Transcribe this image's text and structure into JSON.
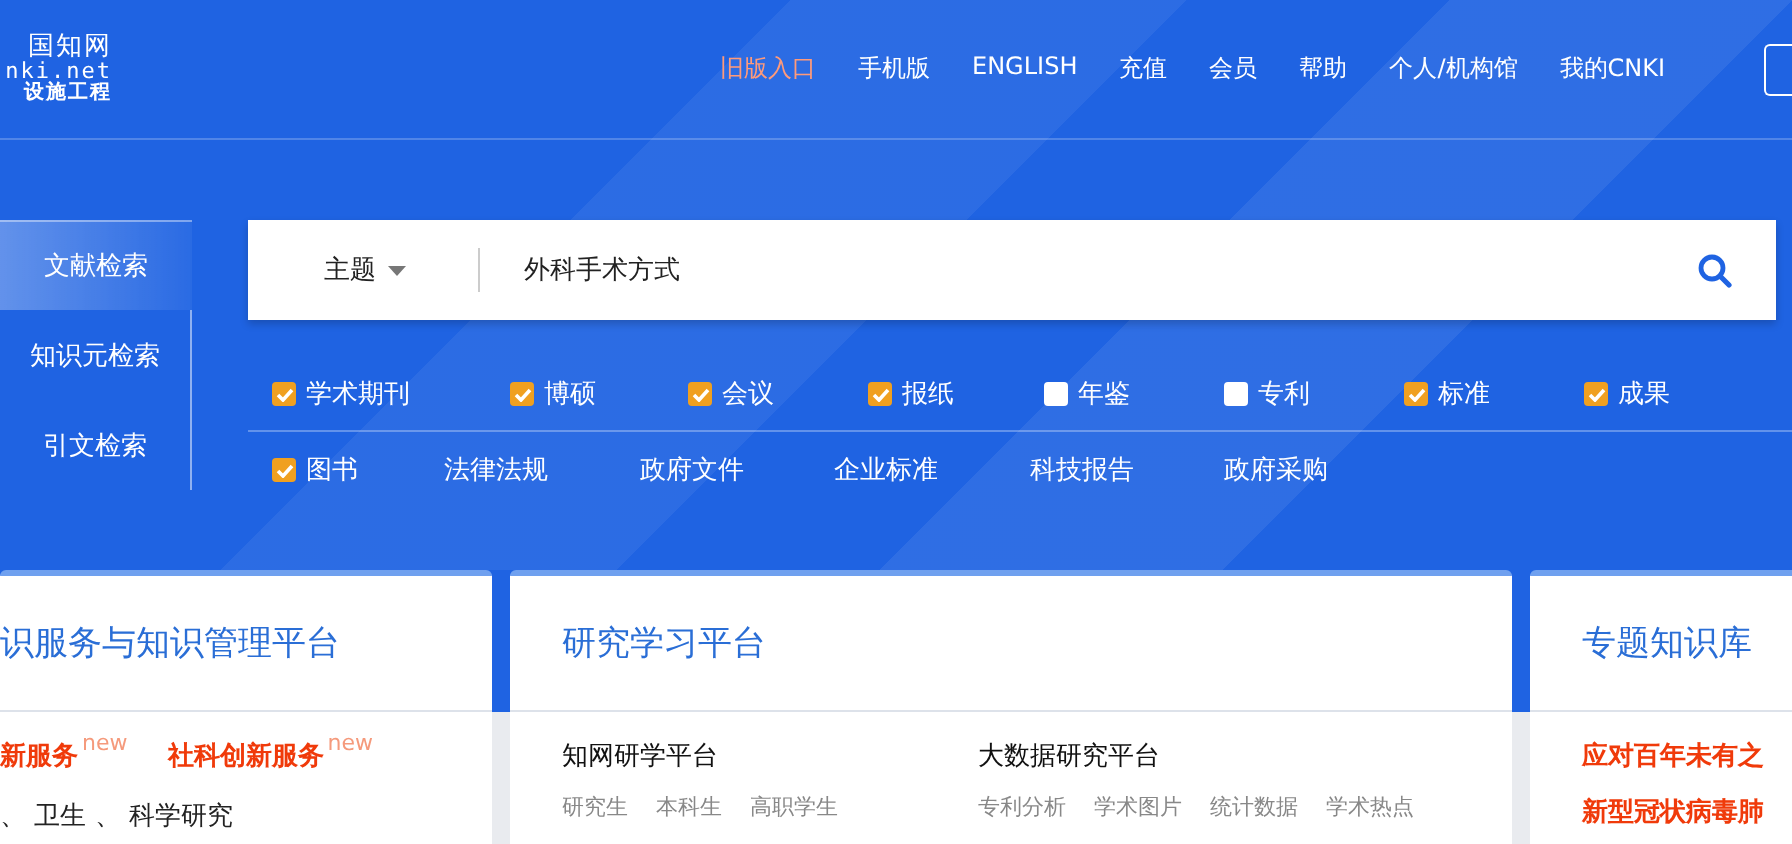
{
  "logo": {
    "title": "国知网",
    "domain": "nki.net",
    "tagline": "设施工程"
  },
  "nav": [
    {
      "label": "旧版入口",
      "highlighted": true
    },
    {
      "label": "手机版",
      "highlighted": false
    },
    {
      "label": "ENGLISH",
      "highlighted": false
    },
    {
      "label": "充值",
      "highlighted": false
    },
    {
      "label": "会员",
      "highlighted": false
    },
    {
      "label": "帮助",
      "highlighted": false
    },
    {
      "label": "个人/机构馆",
      "highlighted": false
    },
    {
      "label": "我的CNKI",
      "highlighted": false
    }
  ],
  "search_tabs": [
    {
      "label": "文献检索",
      "selected": true
    },
    {
      "label": "知识元检索",
      "selected": false
    },
    {
      "label": "引文检索",
      "selected": false
    }
  ],
  "search": {
    "field": "主题",
    "value": "外科手术方式"
  },
  "database_rows": [
    [
      {
        "kind": "checkbox",
        "label": "学术期刊",
        "checked": true
      },
      {
        "kind": "checkbox",
        "label": "博硕",
        "checked": true
      },
      {
        "kind": "checkbox",
        "label": "会议",
        "checked": true
      },
      {
        "kind": "checkbox",
        "label": "报纸",
        "checked": true
      },
      {
        "kind": "checkbox",
        "label": "年鉴",
        "checked": false
      },
      {
        "kind": "checkbox",
        "label": "专利",
        "checked": false
      },
      {
        "kind": "checkbox",
        "label": "标准",
        "checked": true
      },
      {
        "kind": "checkbox",
        "label": "成果",
        "checked": true
      }
    ],
    [
      {
        "kind": "checkbox",
        "label": "图书",
        "checked": true
      },
      {
        "kind": "link",
        "label": "法律法规"
      },
      {
        "kind": "link",
        "label": "政府文件"
      },
      {
        "kind": "link",
        "label": "企业标准"
      },
      {
        "kind": "link",
        "label": "科技报告"
      },
      {
        "kind": "link",
        "label": "政府采购"
      }
    ]
  ],
  "service_card": {
    "title": "识服务与知识管理平台",
    "links": [
      {
        "label": "新服务",
        "badge": "new"
      },
      {
        "label": "社科创新服务",
        "badge": "new"
      }
    ],
    "footer": "、 卫生 、 科学研究"
  },
  "study_card": {
    "title": "研究学习平台",
    "platforms": [
      {
        "name": "知网研学平台",
        "links": [
          "研究生",
          "本科生",
          "高职学生"
        ]
      },
      {
        "name": "大数据研究平台",
        "links": [
          "专利分析",
          "学术图片",
          "统计数据",
          "学术热点"
        ]
      }
    ]
  },
  "topic_card": {
    "title": "专题知识库",
    "links": [
      "应对百年未有之",
      "新型冠状病毒肺"
    ]
  }
}
